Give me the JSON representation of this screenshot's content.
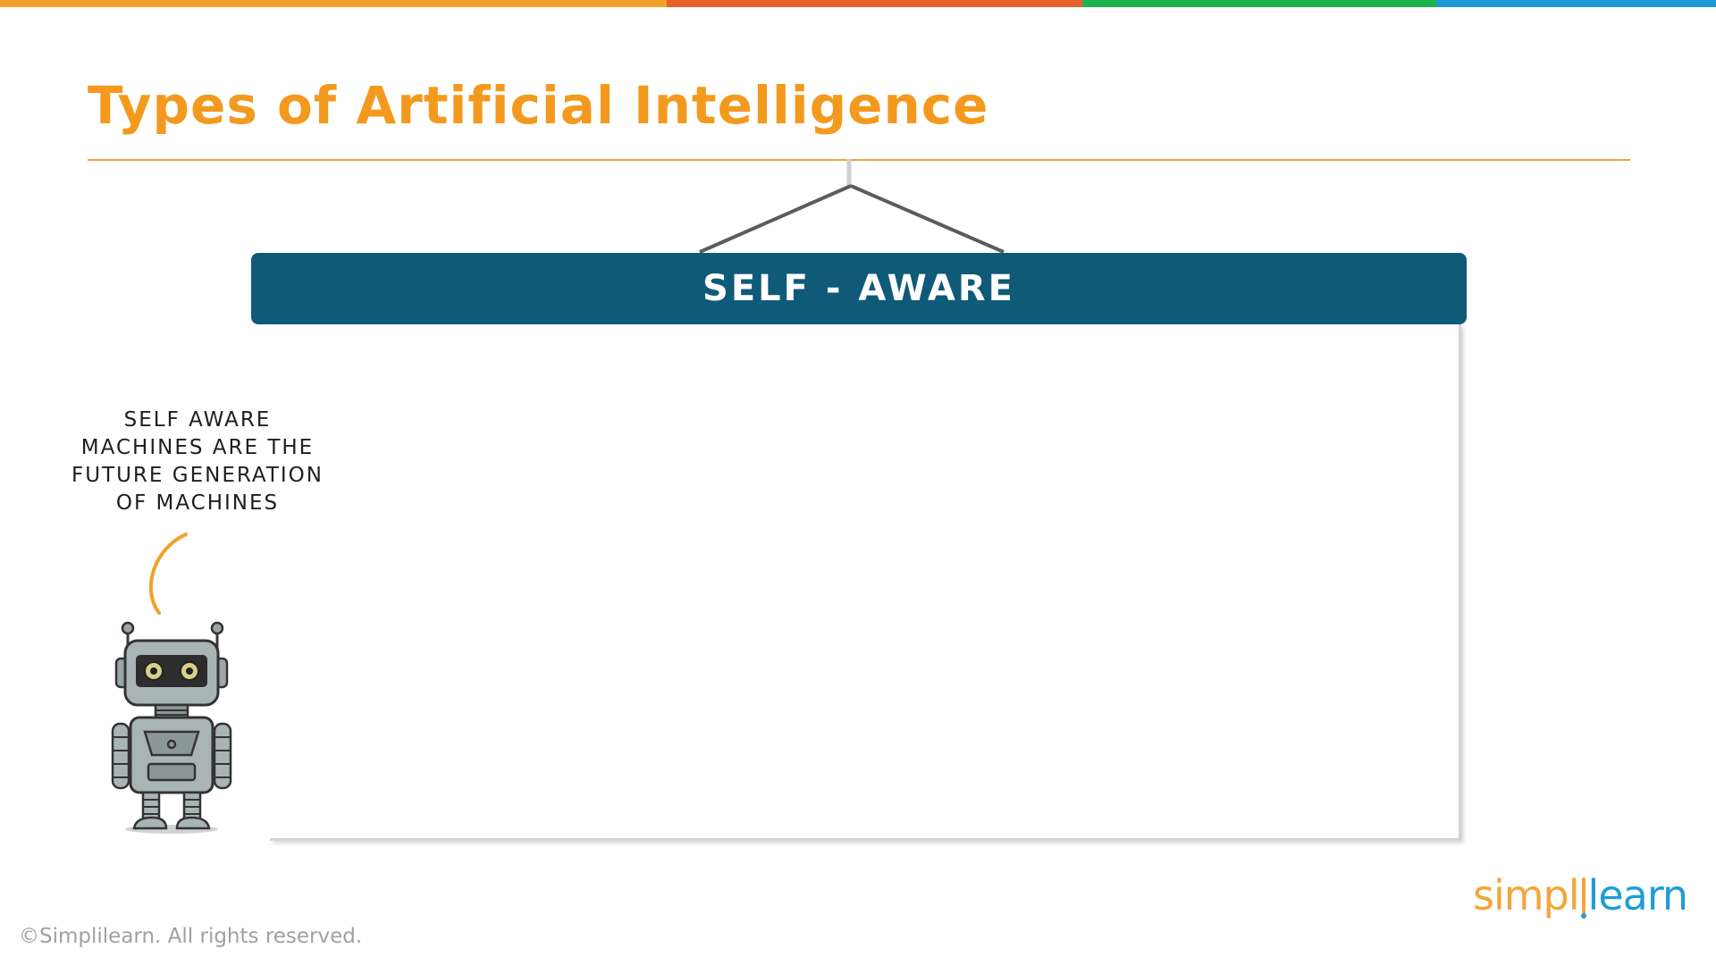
{
  "slide": {
    "title": "Types of Artificial Intelligence",
    "category_label": "SELF - AWARE",
    "speech_lines": [
      "SELF AWARE",
      "MACHINES ARE THE",
      "FUTURE GENERATION",
      "OF MACHINES"
    ],
    "copyright": "©Simplilearn. All rights reserved.",
    "logo": {
      "part_a": "simpl",
      "part_b": "learn"
    },
    "colors": {
      "title": "#f39a1e",
      "banner": "#0f5a78",
      "bar_orange": "#f2a22a",
      "bar_red": "#e8622a",
      "bar_green": "#1db24f",
      "bar_blue": "#1b9ad6"
    },
    "icons": [
      "robot-illustration",
      "speech-bubble-tail",
      "tree-connector",
      "simplilearn-logo"
    ]
  }
}
